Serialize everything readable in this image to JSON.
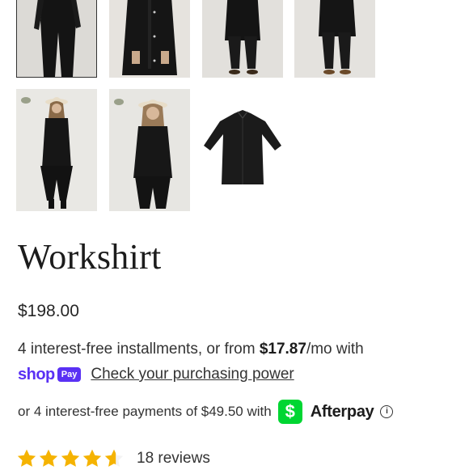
{
  "gallery": {
    "thumbnails": [
      {
        "alt": "product photo 1",
        "selected": true
      },
      {
        "alt": "product photo 2",
        "selected": false
      },
      {
        "alt": "product photo 3",
        "selected": false
      },
      {
        "alt": "product photo 4",
        "selected": false
      },
      {
        "alt": "product photo 5",
        "selected": false
      },
      {
        "alt": "product photo 6",
        "selected": false
      },
      {
        "alt": "product photo 7",
        "selected": false
      }
    ]
  },
  "product": {
    "title": "Workshirt",
    "price": "$198.00"
  },
  "shop_pay": {
    "installments_prefix": "4 interest-free installments, or from ",
    "monthly_amount": "$17.87",
    "installments_suffix": "/mo with",
    "brand_word": "shop",
    "badge": "Pay",
    "link_text": "Check your purchasing power",
    "brand_color": "#5a31f4"
  },
  "afterpay": {
    "text": "or 4 interest-free payments of $49.50 with",
    "cash_icon_glyph": "$",
    "brand": "Afterpay",
    "info_glyph": "i",
    "icon_color": "#00d632"
  },
  "rating": {
    "value": 4.5,
    "max": 5,
    "star_color": "#f5b301",
    "reviews_text": "18 reviews"
  }
}
